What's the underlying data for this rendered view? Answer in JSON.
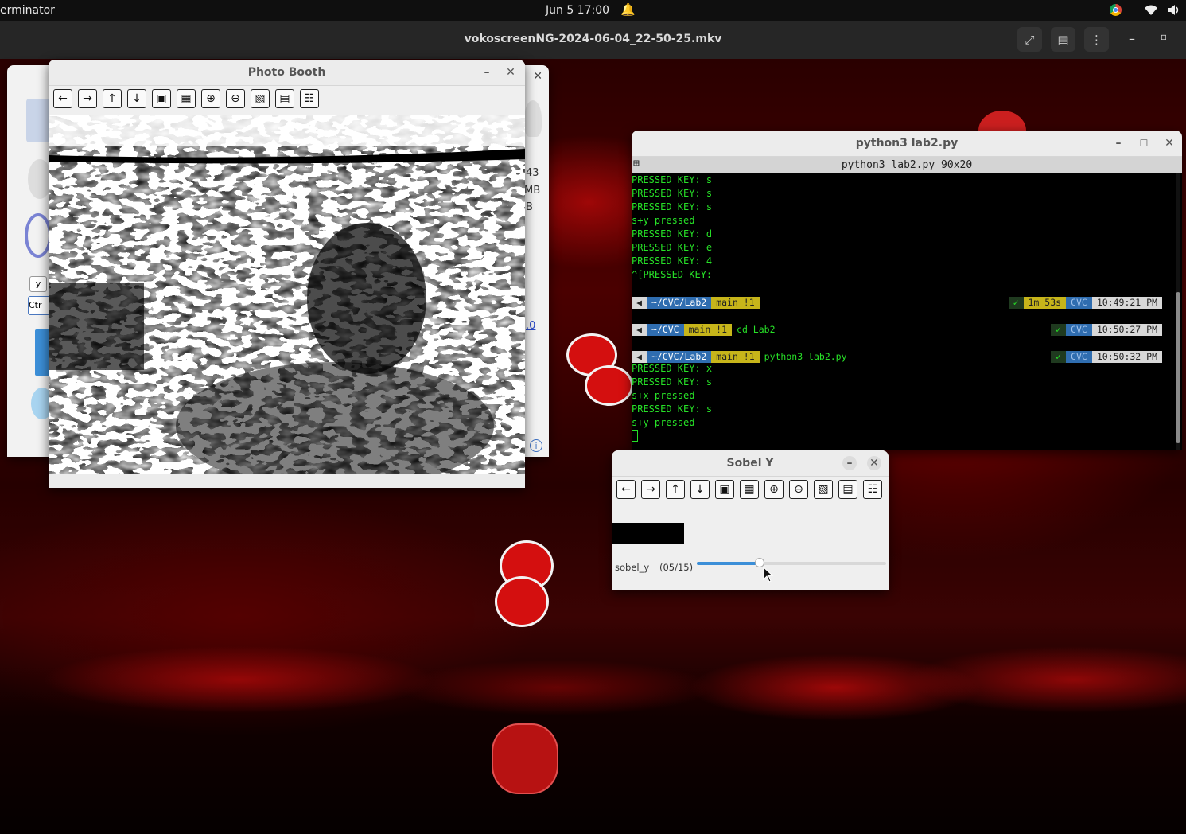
{
  "topbar": {
    "app_name": "erminator",
    "datetime": "Jun 5  17:00"
  },
  "player": {
    "title": "vokoscreenNG-2024-06-04_22-50-25.mkv"
  },
  "photo_booth": {
    "title": "Photo Booth",
    "toolbar_icons": [
      "arrow-left-icon",
      "arrow-right-icon",
      "arrow-up-icon",
      "arrow-down-icon",
      "zoom-fit-icon",
      "zoom-original-icon",
      "zoom-in-icon",
      "zoom-out-icon",
      "save-icon",
      "clipboard-icon",
      "properties-icon"
    ]
  },
  "background_window": {
    "side_labels": [
      "43",
      "MB",
      "B"
    ],
    "link_text": ".0",
    "key_labels": [
      "y",
      "Ctr"
    ]
  },
  "terminal": {
    "title": "python3 lab2.py",
    "tab_title": "python3 lab2.py 90x20",
    "lines_top": [
      "PRESSED KEY: s",
      "PRESSED KEY: s",
      "PRESSED KEY: s",
      "s+y pressed",
      "PRESSED KEY: d",
      "PRESSED KEY: e",
      "PRESSED KEY: 4",
      "^[PRESSED KEY:"
    ],
    "prompts": [
      {
        "path": "~/CVC/Lab2",
        "git": "main !1",
        "command": "",
        "duration": "1m 53s",
        "env": "CVC",
        "time": "10:49:21 PM"
      },
      {
        "path": "~/CVC",
        "git": "main !1",
        "command": "cd Lab2",
        "duration": "",
        "env": "CVC",
        "time": "10:50:27 PM"
      },
      {
        "path": "~/CVC/Lab2",
        "git": "main !1",
        "command": "python3 lab2.py",
        "duration": "",
        "env": "CVC",
        "time": "10:50:32 PM"
      }
    ],
    "lines_bottom": [
      "PRESSED KEY: x",
      "PRESSED KEY: s",
      "s+x pressed",
      "PRESSED KEY: s",
      "s+y pressed"
    ]
  },
  "sobel": {
    "title": "Sobel Y",
    "trackbar_name": "sobel_y",
    "trackbar_value": "(05/15)",
    "trackbar_fraction": 0.333
  },
  "colors": {
    "terminal_green": "#27e027",
    "powerline_yellow": "#c7b51a",
    "powerline_blue": "#2f6db0",
    "slider_blue": "#3c8fd8"
  }
}
